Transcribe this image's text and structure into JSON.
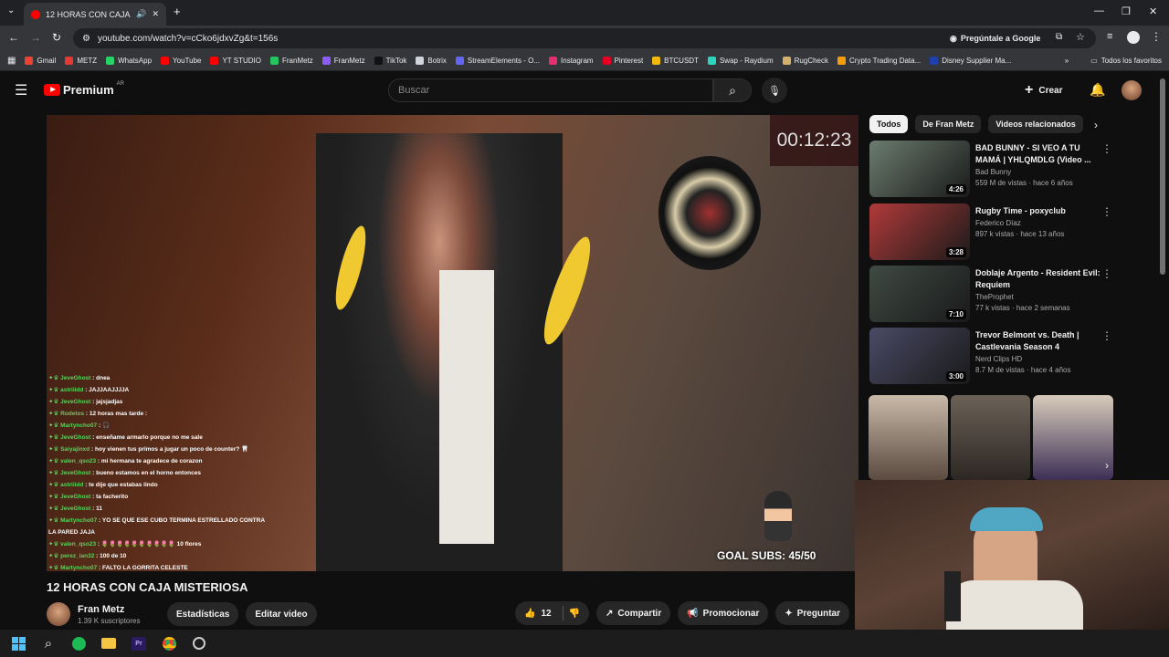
{
  "browser": {
    "tab_title": "12 HORAS CON CAJA MISTERIOSA",
    "url": "youtube.com/watch?v=cCko6jdxvZg&t=156s",
    "ask_google": "Pregúntale a Google"
  },
  "bookmarks": [
    {
      "label": "Gmail",
      "color": "#ea4335"
    },
    {
      "label": "METZ",
      "color": "#e53935"
    },
    {
      "label": "WhatsApp",
      "color": "#25d366"
    },
    {
      "label": "YouTube",
      "color": "#ff0000"
    },
    {
      "label": "YT STUDIO",
      "color": "#ff0000"
    },
    {
      "label": "FranMetz",
      "color": "#22c55e"
    },
    {
      "label": "FranMetz",
      "color": "#8b5cf6"
    },
    {
      "label": "TikTok",
      "color": "#111111"
    },
    {
      "label": "Botrix",
      "color": "#d1d5db"
    },
    {
      "label": "StreamElements - O...",
      "color": "#6366f1"
    },
    {
      "label": "Instagram",
      "color": "#e1306c"
    },
    {
      "label": "Pinterest",
      "color": "#e60023"
    },
    {
      "label": "BTCUSDT",
      "color": "#f0b90b"
    },
    {
      "label": "Swap - Raydium",
      "color": "#2dd4bf"
    },
    {
      "label": "RugCheck",
      "color": "#d4b26a"
    },
    {
      "label": "Crypto Trading Data...",
      "color": "#f59e0b"
    },
    {
      "label": "Disney Supplier Ma...",
      "color": "#1e40af"
    }
  ],
  "bookmarks_all": "Todos los favoritos",
  "yt": {
    "logo": "Premium",
    "logo_sup": "AR",
    "search_placeholder": "Buscar",
    "create": "Crear"
  },
  "video": {
    "timer": "00:12:23",
    "goal": "GOAL SUBS: 45/50",
    "title": "12 HORAS CON CAJA MISTERIOSA",
    "channel": "Fran Metz",
    "subs": "1.39 K suscriptores",
    "stats_btn": "Estadísticas",
    "edit_btn": "Editar video",
    "likes": "12",
    "share": "Compartir",
    "promote": "Promocionar",
    "ask": "Preguntar"
  },
  "chat": [
    {
      "user": "JeveGhost",
      "msg": "dnea"
    },
    {
      "user": "astriiidd",
      "msg": "JAJJAAJJJJA"
    },
    {
      "user": "JeveGhost",
      "msg": "jajsjadjas"
    },
    {
      "user": "Rodetos",
      "msg": "12 horas mas tarde :"
    },
    {
      "user": "Martyncho07",
      "msg": "🎧"
    },
    {
      "user": "JeveGhost",
      "msg": "enseñame armarlo porque no me sale"
    },
    {
      "user": "Saiyajinxd",
      "msg": "hoy vienen tus primos a jugar un poco de counter? 🦷"
    },
    {
      "user": "valen_qso23",
      "msg": "mi hermana te agradece de corazon"
    },
    {
      "user": "JeveGhost",
      "msg": "bueno estamos en el horno entonces"
    },
    {
      "user": "astriiidd",
      "msg": "te dije que estabas lindo"
    },
    {
      "user": "JeveGhost",
      "msg": "ta facherito"
    },
    {
      "user": "JeveGhost",
      "msg": "11"
    },
    {
      "user": "Martyncho07",
      "msg": "YO SE QUE ESE CUBO TERMINA ESTRELLADO CONTRA"
    },
    {
      "user": "",
      "msg": "LA PARED JAJA"
    },
    {
      "user": "valen_qso23",
      "msg": "🌷🌷🌷🌷🌷🌷🌷🌷🌷🌷 10 flores"
    },
    {
      "user": "perez_ian32",
      "msg": "100 de 10"
    },
    {
      "user": "Martyncho07",
      "msg": "FALTO LA GORRITA CELESTE"
    }
  ],
  "chips": [
    "Todos",
    "De Fran Metz",
    "Videos relacionados"
  ],
  "recommended": [
    {
      "title": "BAD BUNNY - SI VEO A TU MAMÁ | YHLQMDLG (Video ...",
      "channel": "Bad Bunny",
      "meta": "559 M de vistas · hace 6 años",
      "duration": "4:26",
      "thumb": "#6b7c6f"
    },
    {
      "title": "Rugby Time - poxyclub",
      "channel": "Federico Díaz",
      "meta": "897 k vistas · hace 13 años",
      "duration": "3:28",
      "thumb": "#b23a3a"
    },
    {
      "title": "Doblaje Argento - Resident Evil: Requiem",
      "channel": "TheProphet",
      "meta": "77 k vistas · hace 2 semanas",
      "duration": "7:10",
      "thumb": "#3f4a44"
    },
    {
      "title": "Trevor Belmont vs. Death | Castlevania Season 4",
      "channel": "Nerd Clips HD",
      "meta": "8.7 M de vistas · hace 4 años",
      "duration": "3:00",
      "thumb": "#4a4a66"
    }
  ]
}
